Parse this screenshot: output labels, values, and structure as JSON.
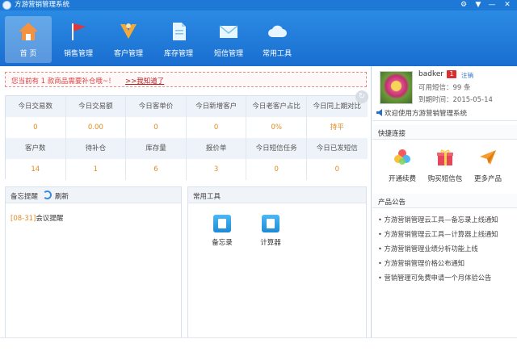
{
  "window": {
    "title": "方游营销管理系统"
  },
  "nav": [
    {
      "label": "首 页",
      "icon": "home-icon",
      "active": true
    },
    {
      "label": "销售管理",
      "icon": "flag-icon",
      "active": false
    },
    {
      "label": "客户管理",
      "icon": "customer-icon",
      "active": false
    },
    {
      "label": "库存管理",
      "icon": "document-icon",
      "active": false
    },
    {
      "label": "短信管理",
      "icon": "envelope-icon",
      "active": false
    },
    {
      "label": "常用工具",
      "icon": "cloud-icon",
      "active": false
    }
  ],
  "notice": {
    "text": "您当前有 1 款商品需要补仓哦~！",
    "link": ">>我知道了"
  },
  "stats": {
    "row1_labels": [
      "今日交易数",
      "今日交易额",
      "今日客单价",
      "今日新增客户",
      "今日老客户占比",
      "今日同上期对比"
    ],
    "row1_values": [
      "0",
      "0.00",
      "0",
      "0",
      "0%",
      "持平"
    ],
    "row2_labels": [
      "客户数",
      "待补仓",
      "库存量",
      "报价单",
      "今日短信任务",
      "今日已发短信"
    ],
    "row2_values": [
      "14",
      "1",
      "6",
      "3",
      "0",
      "0"
    ]
  },
  "memo": {
    "title": "备忘提醒",
    "refresh": "刷新",
    "items": [
      {
        "date": "[08-31]",
        "text": "会议提醒"
      }
    ]
  },
  "tools": {
    "title": "常用工具",
    "items": [
      {
        "label": "备忘录",
        "icon": "notebook-icon"
      },
      {
        "label": "计算器",
        "icon": "calculator-icon"
      }
    ]
  },
  "user": {
    "name": "badker",
    "badge": "1",
    "logout": "注销",
    "sms_line": "可用短信：99 条",
    "expire_line": "到期时间：2015-05-14",
    "welcome": "欢迎使用方游营销管理系统"
  },
  "quick_links": {
    "title": "快捷连接",
    "items": [
      {
        "label": "开通续费",
        "icon": "colorwheel-icon"
      },
      {
        "label": "购买短信包",
        "icon": "gift-icon"
      },
      {
        "label": "更多产品",
        "icon": "paper-plane-icon"
      }
    ]
  },
  "announcements": {
    "title": "产品公告",
    "items": [
      "方游营销管理云工具—备忘录上线通知",
      "方游营销管理云工具—计算器上线通知",
      "方游营销管理业绩分析功能上线",
      "方游营销管理价格公布通知",
      "营销管理可免费申请一个月体验公告"
    ]
  },
  "colors": {
    "accent": "#1e78d6",
    "value": "#e08a1f",
    "warning": "#d84545"
  }
}
